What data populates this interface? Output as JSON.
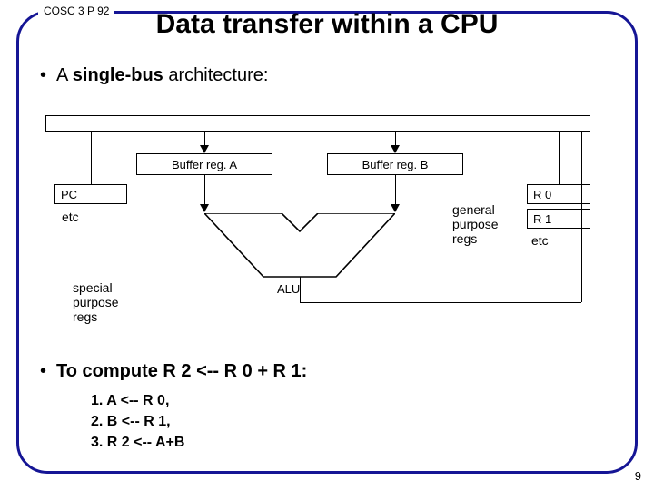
{
  "course_tag": "COSC 3 P 92",
  "title": "Data transfer within a CPU",
  "bullet_arch_prefix": "A ",
  "bullet_arch_bold": "single-bus",
  "bullet_arch_suffix": " architecture:",
  "bullet_compute": "To compute R 2 <-- R 0 + R 1:",
  "steps": {
    "s1": "1. A <-- R 0,",
    "s2": "2. B <-- R 1,",
    "s3": "3. R 2 <-- A+B"
  },
  "diagram": {
    "buffer_a": "Buffer reg. A",
    "buffer_b": "Buffer reg. B",
    "pc": "PC",
    "etc_left": "etc",
    "r0": "R 0",
    "r1": "R 1",
    "etc_right": "etc",
    "gen_label": "general\npurpose\nregs",
    "spc_label": "special\npurpose\nregs",
    "alu": "ALU"
  },
  "page_number": "9"
}
